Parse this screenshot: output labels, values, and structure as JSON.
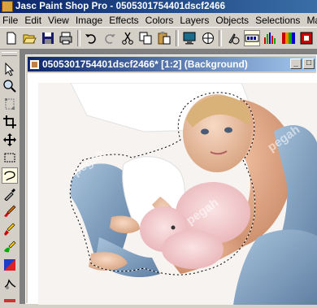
{
  "app": {
    "title": "Jasc Paint Shop Pro - 0505301754401dscf2466"
  },
  "menu": [
    "File",
    "Edit",
    "View",
    "Image",
    "Effects",
    "Colors",
    "Layers",
    "Objects",
    "Selections",
    "Mask"
  ],
  "toolbar": {
    "buttons": [
      "new-icon",
      "open-icon",
      "save-icon",
      "print-icon",
      "undo-icon",
      "redo-icon",
      "cut-icon",
      "copy-icon",
      "paste-icon",
      "full-screen-icon",
      "browse-icon",
      "tool-palette-icon",
      "toolbar-icon",
      "histogram-icon",
      "layer-palette-icon",
      "overview-icon"
    ]
  },
  "tools": [
    "arrow-icon",
    "zoom-icon",
    "deformation-icon",
    "crop-icon",
    "mover-icon",
    "selection-icon",
    "freehand-selection-icon",
    "dropper-icon",
    "paint-brush-icon",
    "clone-brush-icon",
    "color-replacer-icon",
    "retouch-icon",
    "scratch-remover-icon",
    "eraser-icon"
  ],
  "document": {
    "title": "0505301754401dscf2466* [1:2] (Background)",
    "watermark": "pegah"
  },
  "colors": {
    "titlebar_start": "#0a246a",
    "titlebar_end": "#3a6ea5",
    "chrome": "#d4d0c8",
    "workspace": "#808080"
  }
}
